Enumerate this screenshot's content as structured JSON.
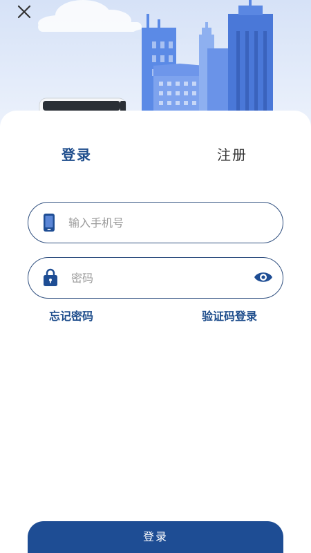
{
  "header": {
    "close_icon": "close-icon"
  },
  "illustration": {
    "name": "city-bus-illustration",
    "accent": "#4a78d8"
  },
  "tabs": {
    "login": "登录",
    "register": "注册"
  },
  "form": {
    "phone_placeholder": "输入手机号",
    "phone_icon": "mobile-phone-icon",
    "password_placeholder": "密码",
    "password_icon": "lock-icon",
    "toggle_icon": "eye-icon"
  },
  "links": {
    "forgot_password": "忘记密码",
    "code_login": "验证码登录"
  },
  "actions": {
    "login_button": "登录"
  },
  "colors": {
    "primary": "#1e4d94",
    "border": "#2f4f7f",
    "text": "#333333"
  }
}
